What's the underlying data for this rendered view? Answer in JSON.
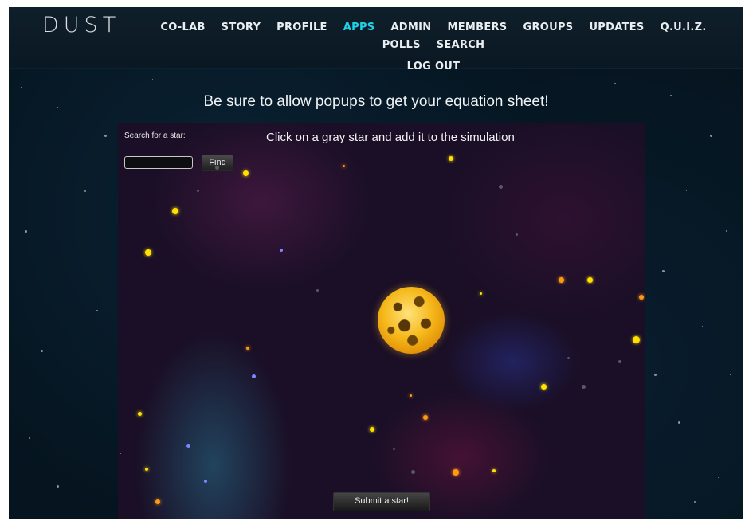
{
  "header": {
    "logo": "DUST",
    "nav_row1": [
      "CO-LAB",
      "STORY",
      "PROFILE",
      "APPS",
      "ADMIN",
      "MEMBERS",
      "GROUPS",
      "UPDATES",
      "Q.U.I.Z.",
      "POLLS",
      "SEARCH"
    ],
    "nav_row2": [
      "LOG OUT"
    ],
    "active": "APPS",
    "active_color": "#1fd3e6"
  },
  "banner": "Be sure to allow popups to get your equation sheet!",
  "simulation": {
    "search_label": "Search for a star:",
    "search_value": "",
    "find_label": "Find",
    "instruction": "Click on a gray star and add it to the simulation",
    "submit_label": "Submit a star!"
  },
  "colors": {
    "background": "#05141f",
    "star_yellow": "#ffe000",
    "star_orange": "#ff9a10",
    "star_gray": "#5a5a66"
  }
}
